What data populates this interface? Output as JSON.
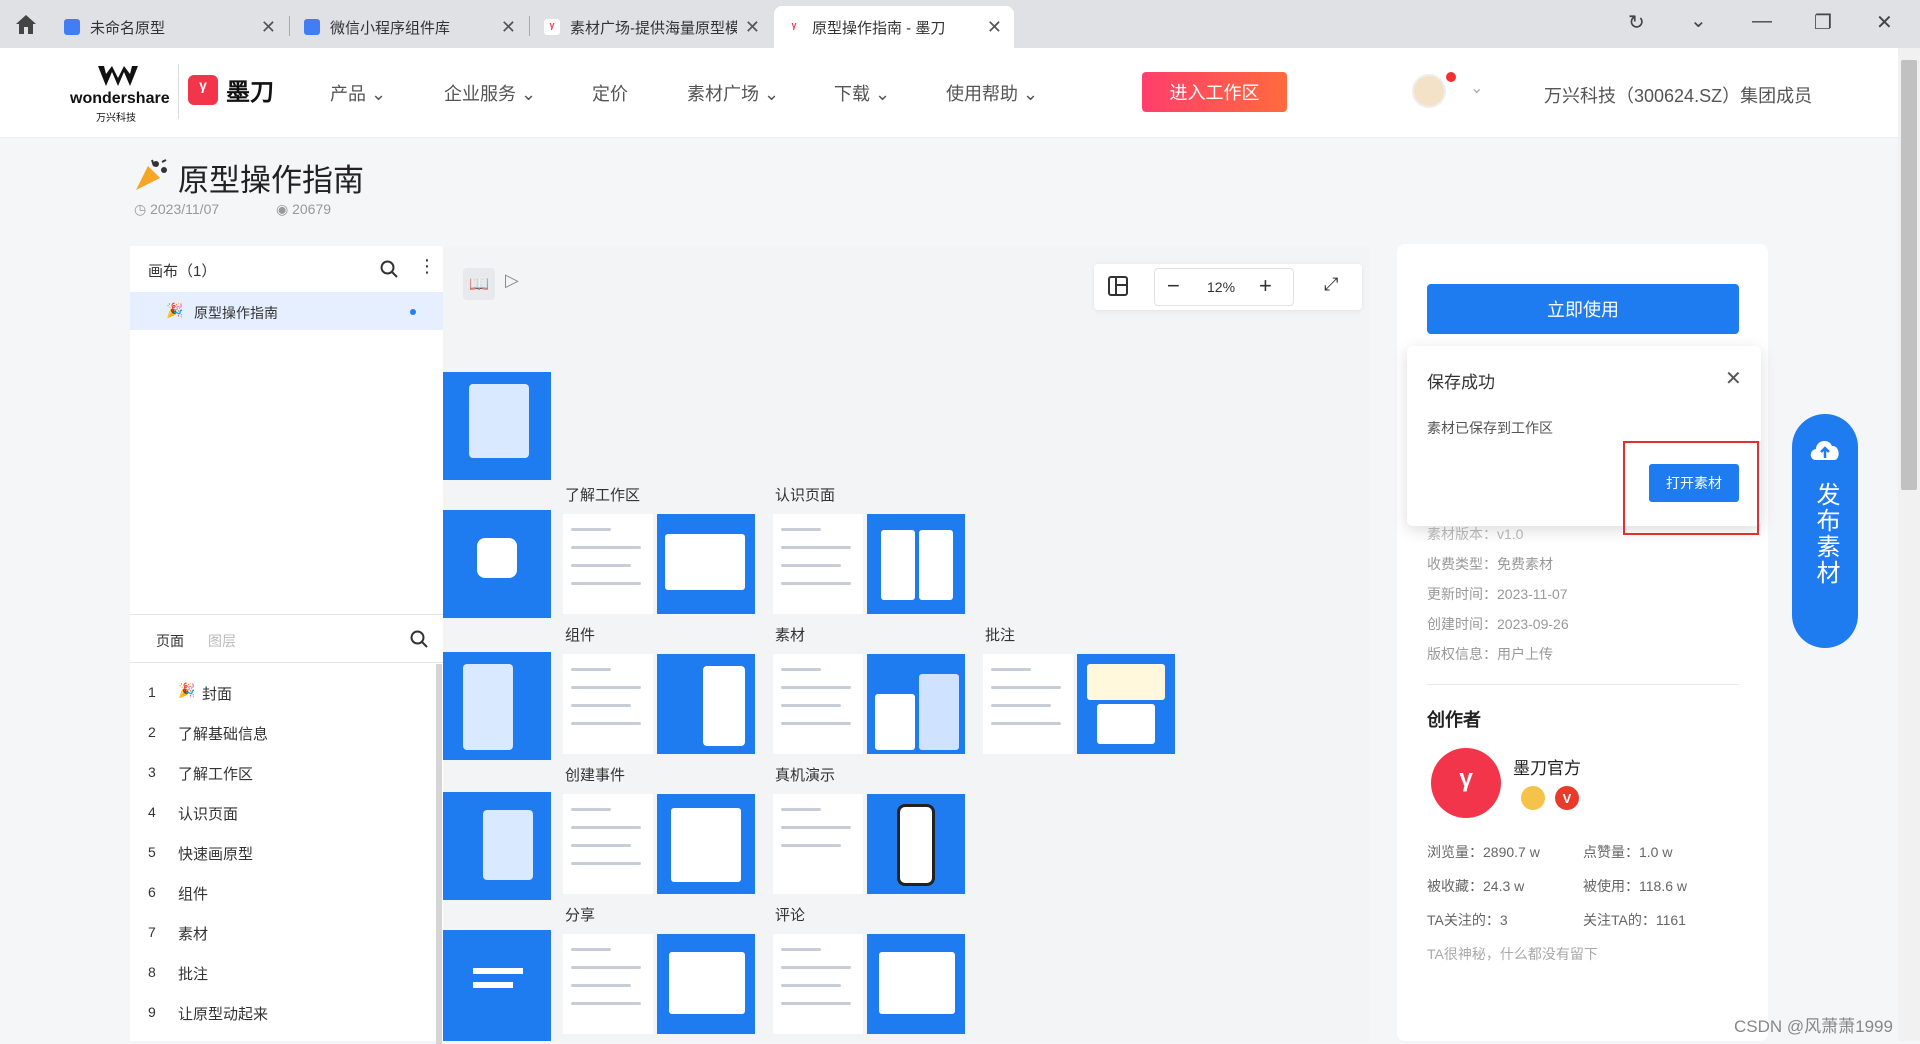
{
  "browser": {
    "tabs": [
      {
        "label": "未命名原型"
      },
      {
        "label": "微信小程序组件库"
      },
      {
        "label": "素材广场-提供海量原型模"
      },
      {
        "label": "原型操作指南 - 墨刀"
      }
    ]
  },
  "header": {
    "brand": "wondershare",
    "brand_sub": "万兴科技",
    "logo_text": "墨刀",
    "nav": [
      "产品",
      "企业服务",
      "定价",
      "素材广场",
      "下载",
      "使用帮助"
    ],
    "cta": "进入工作区",
    "group_text": "万兴科技（300624.SZ）集团成员"
  },
  "doc": {
    "title": "原型操作指南",
    "date": "2023/11/07",
    "views": "20679"
  },
  "left_panel": {
    "canvas_header": "画布（1）",
    "canvas_item": "原型操作指南",
    "tabs": [
      "页面",
      "图层"
    ],
    "pages": [
      {
        "num": "1",
        "label": "封面"
      },
      {
        "num": "2",
        "label": "了解基础信息"
      },
      {
        "num": "3",
        "label": "了解工作区"
      },
      {
        "num": "4",
        "label": "认识页面"
      },
      {
        "num": "5",
        "label": "快速画原型"
      },
      {
        "num": "6",
        "label": "组件"
      },
      {
        "num": "7",
        "label": "素材"
      },
      {
        "num": "8",
        "label": "批注"
      },
      {
        "num": "9",
        "label": "让原型动起来"
      }
    ]
  },
  "canvas": {
    "zoom": "12%",
    "cards": [
      "了解工作区",
      "认识页面",
      "组件",
      "素材",
      "批注",
      "创建事件",
      "真机演示",
      "分享",
      "评论"
    ]
  },
  "right_panel": {
    "use_button": "立即使用",
    "toast_title": "保存成功",
    "toast_body": "素材已保存到工作区",
    "toast_button": "打开素材",
    "info": [
      {
        "label": "素材版本：",
        "value": "v1.0"
      },
      {
        "label": "收费类型：",
        "value": "免费素材"
      },
      {
        "label": "更新时间：",
        "value": "2023-11-07"
      },
      {
        "label": "创建时间：",
        "value": "2023-09-26"
      },
      {
        "label": "版权信息：",
        "value": "用户上传"
      }
    ],
    "author_heading": "创作者",
    "author_name": "墨刀官方",
    "stats": [
      {
        "label": "浏览量：",
        "value": "2890.7 w"
      },
      {
        "label": "点赞量：",
        "value": "1.0 w"
      },
      {
        "label": "被收藏：",
        "value": "24.3 w"
      },
      {
        "label": "被使用：",
        "value": "118.6 w"
      },
      {
        "label": "TA关注的：",
        "value": "3"
      },
      {
        "label": "关注TA的：",
        "value": "1161"
      }
    ],
    "bio": "TA很神秘，什么都没有留下"
  },
  "publish": {
    "label": "发布素材"
  },
  "watermark": "CSDN @风萧萧1999"
}
